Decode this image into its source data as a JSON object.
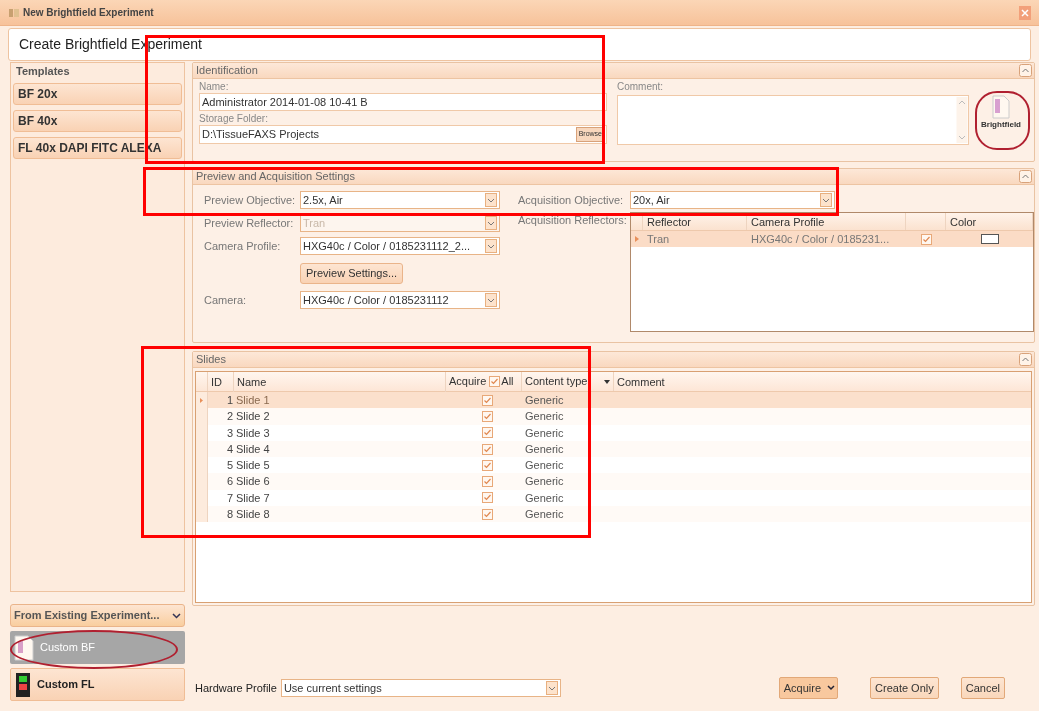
{
  "window": {
    "title": "New Brightfield Experiment"
  },
  "header": {
    "title": "Create Brightfield Experiment"
  },
  "templates": {
    "title": "Templates",
    "items": [
      {
        "label": "BF 20x",
        "selected": false
      },
      {
        "label": "BF 40x",
        "selected": false
      },
      {
        "label": "FL 40x DAPI FITC ALEXA",
        "selected": false
      }
    ]
  },
  "from_existing": {
    "label": "From Existing Experiment..."
  },
  "custom_buttons": [
    {
      "label": "Custom BF",
      "selected": true
    },
    {
      "label": "Custom FL",
      "selected": false
    }
  ],
  "identification": {
    "title": "Identification",
    "name_label": "Name:",
    "name_value": "Administrator 2014-01-08 10-41 B",
    "folder_label": "Storage Folder:",
    "folder_value": "D:\\TissueFAXS Projects",
    "browse": "Browse",
    "comment_label": "Comment:",
    "mode_label": "Brightfield"
  },
  "settings": {
    "title": "Preview and Acquisition Settings",
    "fields": [
      {
        "label": "Preview Objective:",
        "value": "2.5x, Air",
        "disabled": false
      },
      {
        "label": "Preview Reflector:",
        "value": "Tran",
        "disabled": true
      },
      {
        "label": "Camera Profile:",
        "value": "HXG40c / Color  / 0185231112_2...",
        "disabled": false
      }
    ],
    "preview_settings": "Preview Settings...",
    "camera": {
      "label": "Camera:",
      "value": "HXG40c / Color  / 0185231112"
    },
    "acquisition_objective": {
      "label": "Acquisition Objective:",
      "value": "20x, Air"
    },
    "reflectors_label": "Acquisition Reflectors:",
    "reflector_columns": {
      "reflector": "Reflector",
      "camera_profile": "Camera Profile",
      "swatch_column": "Color"
    },
    "reflector_rows": [
      {
        "reflector": "Tran",
        "camera_profile": "HXG40c / Color  / 0185231...",
        "checked": true,
        "selected": true
      }
    ]
  },
  "slides": {
    "title": "Slides",
    "columns": {
      "id": "ID",
      "name": "Name",
      "acquire": "Acquire",
      "all": "All",
      "content_type": "Content type",
      "comment": "Comment"
    },
    "all_checked": true,
    "rows": [
      {
        "id": "1",
        "name": "Slide 1",
        "acquire": true,
        "content_type": "Generic",
        "selected": true
      },
      {
        "id": "2",
        "name": "Slide 2",
        "acquire": true,
        "content_type": "Generic",
        "selected": false
      },
      {
        "id": "3",
        "name": "Slide 3",
        "acquire": true,
        "content_type": "Generic",
        "selected": false
      },
      {
        "id": "4",
        "name": "Slide 4",
        "acquire": true,
        "content_type": "Generic",
        "selected": false
      },
      {
        "id": "5",
        "name": "Slide 5",
        "acquire": true,
        "content_type": "Generic",
        "selected": false
      },
      {
        "id": "6",
        "name": "Slide 6",
        "acquire": true,
        "content_type": "Generic",
        "selected": false
      },
      {
        "id": "7",
        "name": "Slide 7",
        "acquire": true,
        "content_type": "Generic",
        "selected": false
      },
      {
        "id": "8",
        "name": "Slide 8",
        "acquire": true,
        "content_type": "Generic",
        "selected": false
      }
    ]
  },
  "footer": {
    "hardware_label": "Hardware Profile",
    "hardware_value": "Use current settings",
    "buttons": [
      {
        "label": "Acquire",
        "kind": "split"
      },
      {
        "label": "Create Only",
        "kind": "plain"
      },
      {
        "label": "Cancel",
        "kind": "plain"
      }
    ]
  },
  "annotations": [
    {
      "kind": "box"
    },
    {
      "kind": "box"
    },
    {
      "kind": "box"
    },
    {
      "kind": "ring"
    },
    {
      "kind": "ring"
    }
  ]
}
